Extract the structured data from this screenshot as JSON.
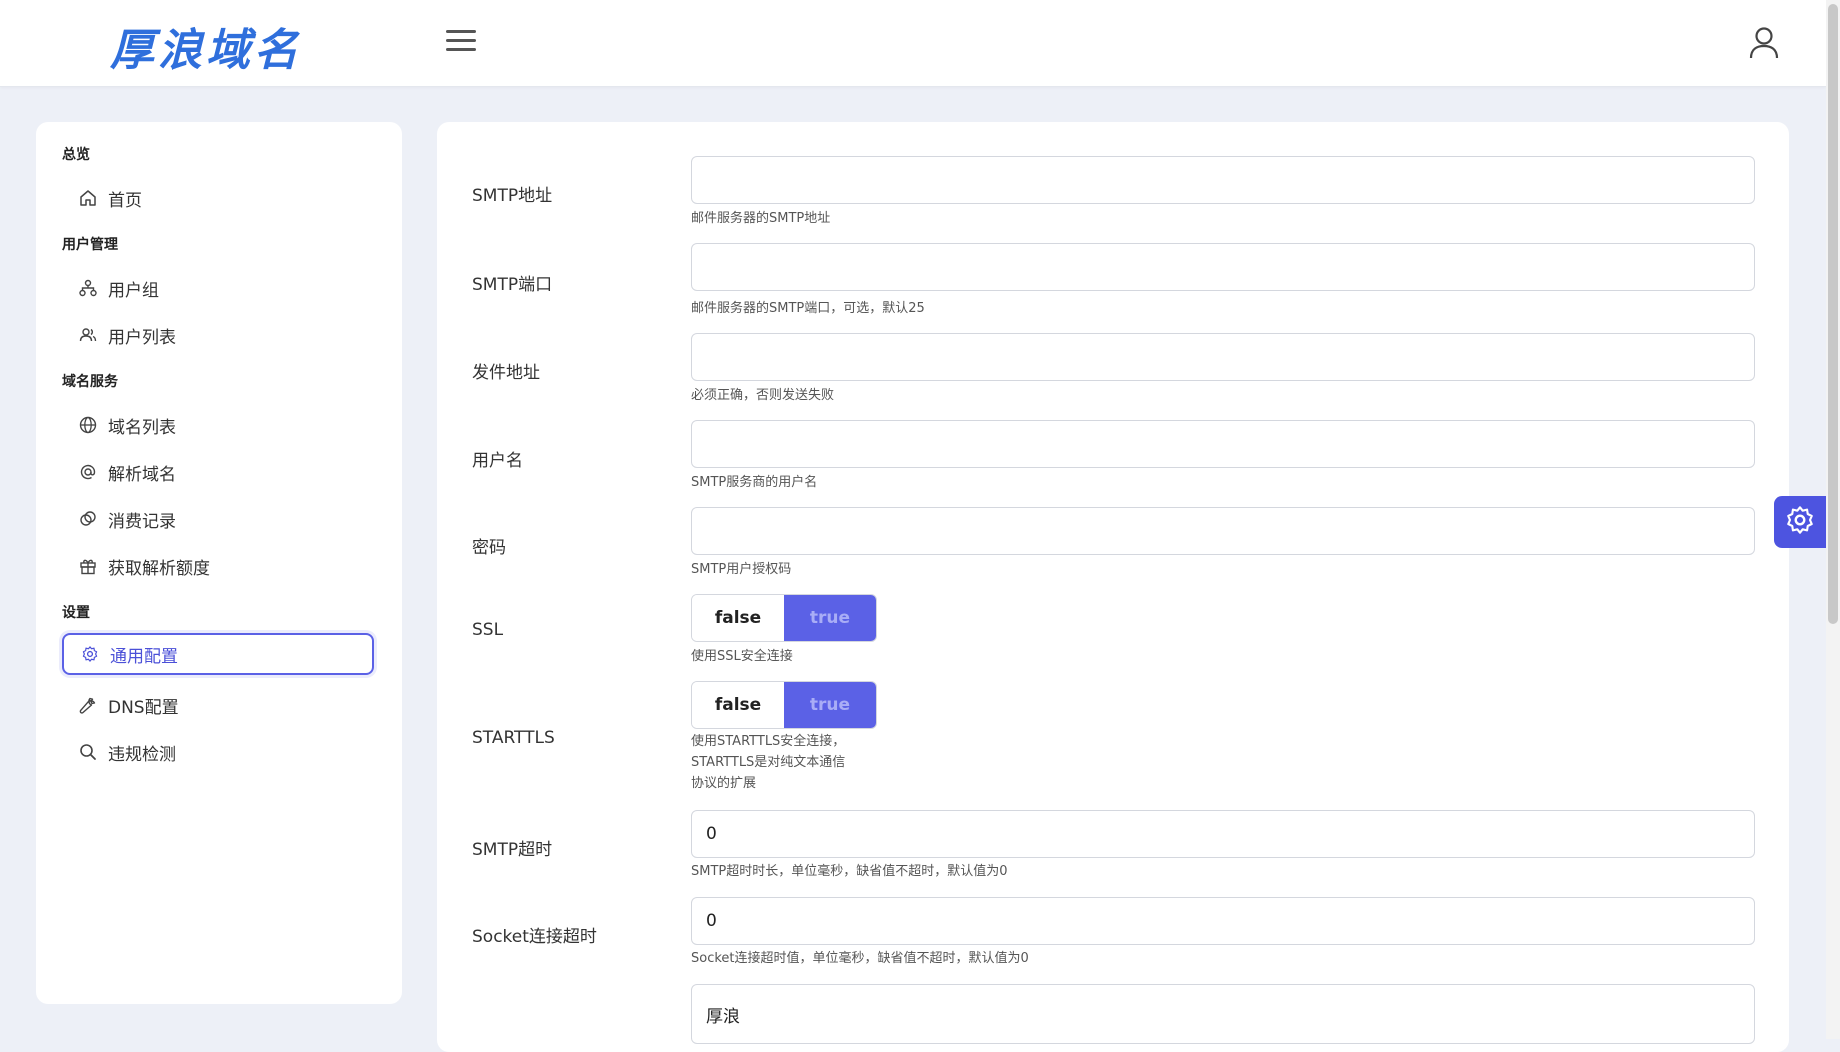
{
  "header": {
    "logo_text": "厚浪域名",
    "menu_icon": "hamburger-menu-icon",
    "user_icon": "user-icon"
  },
  "sidebar": {
    "sections": [
      {
        "title": "总览",
        "items": [
          {
            "label": "首页",
            "icon": "home-icon"
          }
        ]
      },
      {
        "title": "用户管理",
        "items": [
          {
            "label": "用户组",
            "icon": "org-tree-icon"
          },
          {
            "label": "用户列表",
            "icon": "users-icon"
          }
        ]
      },
      {
        "title": "域名服务",
        "items": [
          {
            "label": "域名列表",
            "icon": "globe-icon"
          },
          {
            "label": "解析域名",
            "icon": "at-sign-icon"
          },
          {
            "label": "消费记录",
            "icon": "coins-icon"
          },
          {
            "label": "获取解析额度",
            "icon": "gift-icon"
          }
        ]
      },
      {
        "title": "设置",
        "items": [
          {
            "label": "通用配置",
            "icon": "gear-icon",
            "active": true
          },
          {
            "label": "DNS配置",
            "icon": "wrench-icon"
          },
          {
            "label": "违规检测",
            "icon": "search-icon"
          }
        ]
      }
    ]
  },
  "form": {
    "smtp_host": {
      "label": "SMTP地址",
      "value": "",
      "hint": "邮件服务器的SMTP地址"
    },
    "smtp_port": {
      "label": "SMTP端口",
      "value": "",
      "hint": "邮件服务器的SMTP端口，可选，默认25"
    },
    "from_addr": {
      "label": "发件地址",
      "value": "",
      "hint": "必须正确，否则发送失败"
    },
    "username": {
      "label": "用户名",
      "value": "",
      "hint": "SMTP服务商的用户名"
    },
    "password": {
      "label": "密码",
      "value": "",
      "hint": "SMTP用户授权码"
    },
    "ssl": {
      "label": "SSL",
      "options": [
        "false",
        "true"
      ],
      "selected": "true",
      "hint": "使用SSL安全连接"
    },
    "starttls": {
      "label": "STARTTLS",
      "options": [
        "false",
        "true"
      ],
      "selected": "true",
      "hint_lines": [
        "使用STARTTLS安全连接，",
        "STARTTLS是对纯文本通信",
        "协议的扩展"
      ]
    },
    "smtp_timeout": {
      "label": "SMTP超时",
      "value": "0",
      "hint": "SMTP超时时长，单位毫秒，缺省值不超时，默认值为0"
    },
    "socket_timeout": {
      "label": "Socket连接超时",
      "value": "0",
      "hint": "Socket连接超时值，单位毫秒，缺省值不超时，默认值为0"
    },
    "sender_name": {
      "value": "厚浪"
    }
  },
  "floating": {
    "icon": "gear-icon"
  },
  "colors": {
    "accent": "#5b61e6",
    "logo": "#2f6fdc",
    "background": "#edf0f7"
  }
}
